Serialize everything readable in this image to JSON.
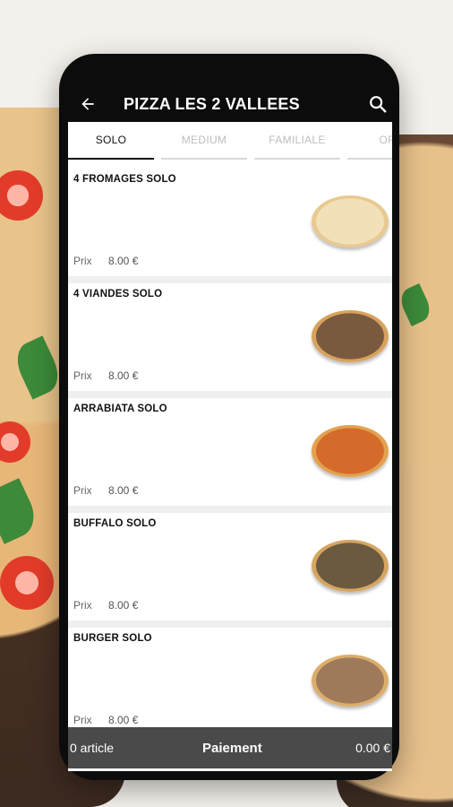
{
  "app": {
    "title": "PIZZA LES 2 VALLEES"
  },
  "icons": {
    "back": "back-arrow-icon",
    "search": "search-icon"
  },
  "tabs": [
    {
      "label": "SOLO",
      "active": true
    },
    {
      "label": "MEDIUM",
      "active": false
    },
    {
      "label": "FAMILIALE",
      "active": false
    },
    {
      "label": "OFF",
      "active": false
    }
  ],
  "items": [
    {
      "name": "4 FROMAGES SOLO",
      "price_label": "Prix",
      "price": "8.00 €",
      "color1": "#f2e1b8",
      "color2": "#e8c98f"
    },
    {
      "name": "4 VIANDES SOLO",
      "price_label": "Prix",
      "price": "8.00 €",
      "color1": "#7a5a3f",
      "color2": "#d8a25e"
    },
    {
      "name": "ARRABIATA SOLO",
      "price_label": "Prix",
      "price": "8.00 €",
      "color1": "#d46b2a",
      "color2": "#e3a24f"
    },
    {
      "name": "BUFFALO SOLO",
      "price_label": "Prix",
      "price": "8.00 €",
      "color1": "#6b5a40",
      "color2": "#d6a560"
    },
    {
      "name": "BURGER SOLO",
      "price_label": "Prix",
      "price": "8.00 €",
      "color1": "#9e7a5b",
      "color2": "#dcae6c"
    }
  ],
  "cart": {
    "count_label": "0 article",
    "pay_label": "Paiement",
    "total": "0.00 €"
  }
}
